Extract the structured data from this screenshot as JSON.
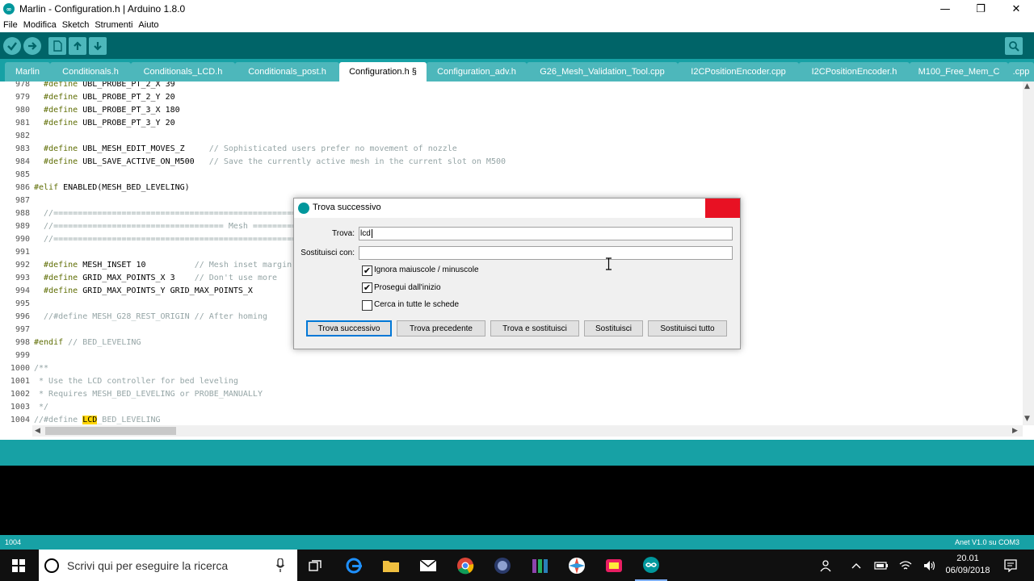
{
  "window": {
    "title": "Marlin - Configuration.h | Arduino 1.8.0",
    "minimize_glyph": "—",
    "restore_glyph": "❐",
    "close_glyph": "✕"
  },
  "menu": [
    "File",
    "Modifica",
    "Sketch",
    "Strumenti",
    "Aiuto"
  ],
  "toolbar": {
    "buttons": [
      "verify-icon",
      "upload-icon",
      "new-icon",
      "open-icon",
      "save-icon"
    ],
    "serial_monitor": "serial-monitor-icon"
  },
  "tabs": [
    "Marlin",
    "Conditionals.h",
    "Conditionals_LCD.h",
    "Conditionals_post.h",
    "Configuration.h §",
    "Configuration_adv.h",
    "G26_Mesh_Validation_Tool.cpp",
    "I2CPositionEncoder.cpp",
    "I2CPositionEncoder.h",
    "M100_Free_Mem_C",
    ".cpp"
  ],
  "active_tab": "Configuration.h §",
  "editor": {
    "lines": [
      {
        "n": "978",
        "segs": [
          {
            "t": "  "
          },
          {
            "t": "#define",
            "c": "kw"
          },
          {
            "t": " UBL_PROBE_PT_2_X 39"
          }
        ]
      },
      {
        "n": "979",
        "segs": [
          {
            "t": "  "
          },
          {
            "t": "#define",
            "c": "kw"
          },
          {
            "t": " UBL_PROBE_PT_2_Y 20"
          }
        ]
      },
      {
        "n": "980",
        "segs": [
          {
            "t": "  "
          },
          {
            "t": "#define",
            "c": "kw"
          },
          {
            "t": " UBL_PROBE_PT_3_X 180"
          }
        ]
      },
      {
        "n": "981",
        "segs": [
          {
            "t": "  "
          },
          {
            "t": "#define",
            "c": "kw"
          },
          {
            "t": " UBL_PROBE_PT_3_Y 20"
          }
        ]
      },
      {
        "n": "982",
        "segs": []
      },
      {
        "n": "983",
        "segs": [
          {
            "t": "  "
          },
          {
            "t": "#define",
            "c": "kw"
          },
          {
            "t": " UBL_MESH_EDIT_MOVES_Z     "
          },
          {
            "t": "// Sophisticated users prefer no movement of nozzle",
            "c": "cm"
          }
        ]
      },
      {
        "n": "984",
        "segs": [
          {
            "t": "  "
          },
          {
            "t": "#define",
            "c": "kw"
          },
          {
            "t": " UBL_SAVE_ACTIVE_ON_M500   "
          },
          {
            "t": "// Save the currently active mesh in the current slot on M500",
            "c": "cm"
          }
        ]
      },
      {
        "n": "985",
        "segs": []
      },
      {
        "n": "986",
        "segs": [
          {
            "t": "#elif",
            "c": "kw"
          },
          {
            "t": " ENABLED(MESH_BED_LEVELING)"
          }
        ]
      },
      {
        "n": "987",
        "segs": []
      },
      {
        "n": "988",
        "segs": [
          {
            "t": "  //==================================================================",
            "c": "cm"
          }
        ]
      },
      {
        "n": "989",
        "segs": [
          {
            "t": "  //=================================== Mesh ===================",
            "c": "cm"
          }
        ]
      },
      {
        "n": "990",
        "segs": [
          {
            "t": "  //==================================================================",
            "c": "cm"
          }
        ]
      },
      {
        "n": "991",
        "segs": []
      },
      {
        "n": "992",
        "segs": [
          {
            "t": "  "
          },
          {
            "t": "#define",
            "c": "kw"
          },
          {
            "t": " MESH_INSET 10          "
          },
          {
            "t": "// Mesh inset margin",
            "c": "cm"
          }
        ]
      },
      {
        "n": "993",
        "segs": [
          {
            "t": "  "
          },
          {
            "t": "#define",
            "c": "kw"
          },
          {
            "t": " GRID_MAX_POINTS_X 3    "
          },
          {
            "t": "// Don't use more",
            "c": "cm"
          }
        ]
      },
      {
        "n": "994",
        "segs": [
          {
            "t": "  "
          },
          {
            "t": "#define",
            "c": "kw"
          },
          {
            "t": " GRID_MAX_POINTS_Y GRID_MAX_POINTS_X"
          }
        ]
      },
      {
        "n": "995",
        "segs": []
      },
      {
        "n": "996",
        "segs": [
          {
            "t": "  //#define MESH_G28_REST_ORIGIN // After homing",
            "c": "cm"
          }
        ]
      },
      {
        "n": "997",
        "segs": []
      },
      {
        "n": "998",
        "segs": [
          {
            "t": "#endif",
            "c": "kw"
          },
          {
            "t": " "
          },
          {
            "t": "// BED_LEVELING",
            "c": "cm"
          }
        ]
      },
      {
        "n": "999",
        "segs": []
      },
      {
        "n": "1000",
        "segs": [
          {
            "t": "/**",
            "c": "cm"
          }
        ]
      },
      {
        "n": "1001",
        "segs": [
          {
            "t": " * Use the LCD controller for bed leveling",
            "c": "cm"
          }
        ]
      },
      {
        "n": "1002",
        "segs": [
          {
            "t": " * Requires MESH_BED_LEVELING or PROBE_MANUALLY",
            "c": "cm"
          }
        ]
      },
      {
        "n": "1003",
        "segs": [
          {
            "t": " */",
            "c": "cm"
          }
        ]
      },
      {
        "n": "1004",
        "segs": [
          {
            "t": "//#define ",
            "c": "cm"
          },
          {
            "t": "LCD",
            "c": "hl"
          },
          {
            "t": "_BED_LEVELING",
            "c": "cm"
          }
        ]
      }
    ]
  },
  "status": {
    "line_number": "1004",
    "board": "Anet V1.0 su COM3"
  },
  "dialog": {
    "title": "Trova successivo",
    "find_label": "Trova:",
    "find_value": "lcd",
    "replace_label": "Sostituisci con:",
    "replace_value": "",
    "options": [
      {
        "label": "Ignora maiuscole / minuscole",
        "checked": true
      },
      {
        "label": "Prosegui dall'inizio",
        "checked": true
      },
      {
        "label": "Cerca in tutte le schede",
        "checked": false
      }
    ],
    "buttons": [
      "Trova successivo",
      "Trova precedente",
      "Trova e sostituisci",
      "Sostituisci",
      "Sostituisci tutto"
    ]
  },
  "taskbar": {
    "search_placeholder": "Scrivi qui per eseguire la ricerca",
    "time": "20.01",
    "date": "06/09/2018"
  },
  "colors": {
    "toolbar": "#006468",
    "tabbar": "#17a1a5",
    "highlight": "#ffd500",
    "close_red": "#e81123"
  }
}
